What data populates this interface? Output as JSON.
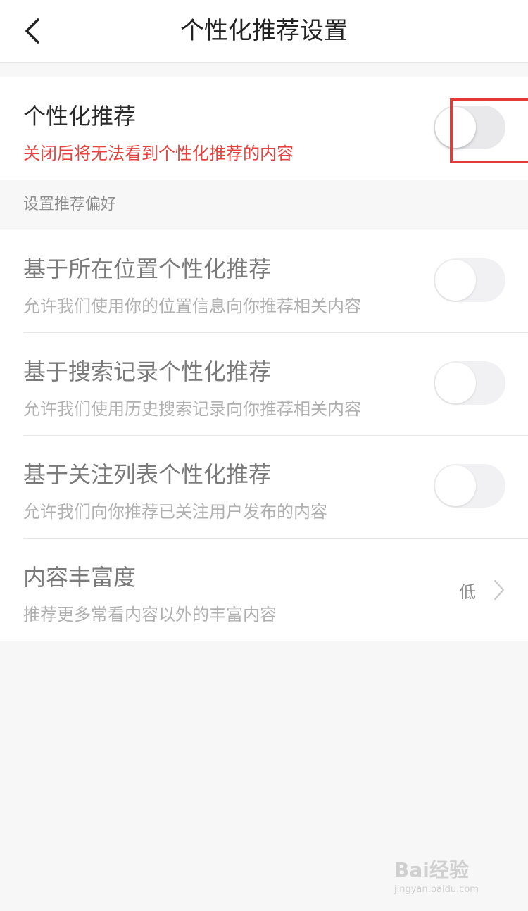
{
  "header": {
    "title": "个性化推荐设置"
  },
  "main_setting": {
    "title": "个性化推荐",
    "subtitle": "关闭后将无法看到个性化推荐的内容",
    "enabled": false
  },
  "preferences": {
    "header": "设置推荐偏好",
    "items": [
      {
        "title": "基于所在位置个性化推荐",
        "subtitle": "允许我们使用你的位置信息向你推荐相关内容",
        "enabled": false
      },
      {
        "title": "基于搜索记录个性化推荐",
        "subtitle": "允许我们使用历史搜索记录向你推荐相关内容",
        "enabled": false
      },
      {
        "title": "基于关注列表个性化推荐",
        "subtitle": "允许我们向你推荐已关注用户发布的内容",
        "enabled": false
      }
    ],
    "richness": {
      "title": "内容丰富度",
      "subtitle": "推荐更多常看内容以外的丰富内容",
      "value": "低"
    }
  },
  "watermark": {
    "brand": "Bai经验",
    "url": "jingyan.baidu.com"
  },
  "colors": {
    "warning": "#e64340",
    "highlight": "#e53935"
  },
  "icons": [
    "back-arrow-icon",
    "chevron-right-icon"
  ]
}
